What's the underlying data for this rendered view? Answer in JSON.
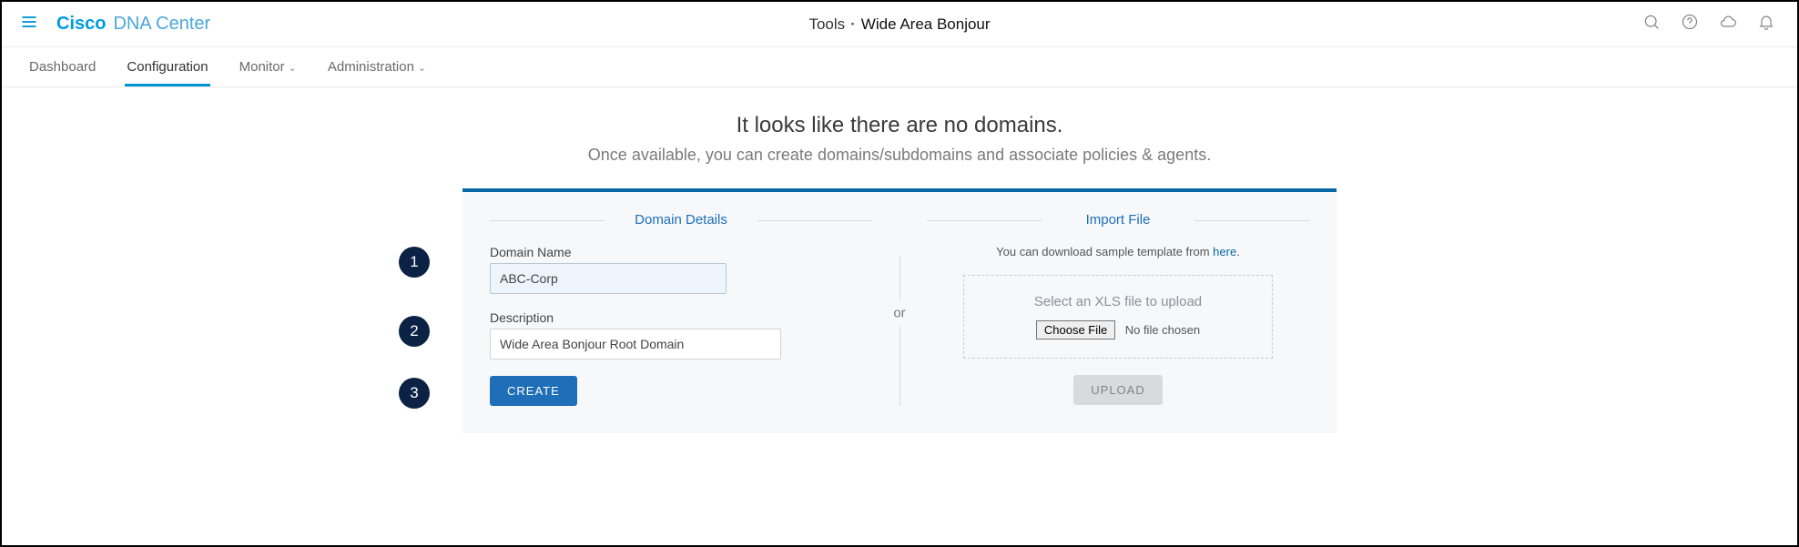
{
  "header": {
    "brand_cisco": "Cisco",
    "brand_dna": "DNA Center",
    "title_tools": "Tools",
    "title_page": "Wide Area Bonjour"
  },
  "tabs": {
    "dashboard": "Dashboard",
    "configuration": "Configuration",
    "monitor": "Monitor",
    "administration": "Administration"
  },
  "empty": {
    "heading": "It looks like there are no domains.",
    "sub": "Once available, you can create domains/subdomains and associate policies & agents."
  },
  "card": {
    "domain_section_title": "Domain Details",
    "domain_name_label": "Domain Name",
    "domain_name_value": "ABC-Corp",
    "description_label": "Description",
    "description_value": "Wide Area Bonjour Root Domain",
    "create_btn": "CREATE",
    "or": "or",
    "import_section_title": "Import File",
    "download_note_prefix": "You can download sample template from ",
    "download_note_link": "here",
    "download_note_suffix": ".",
    "upload_box_title": "Select an XLS file to upload",
    "choose_file_btn": "Choose File",
    "no_file_chosen": "No file chosen",
    "upload_btn": "UPLOAD"
  },
  "callouts": {
    "c1": "1",
    "c2": "2",
    "c3": "3"
  }
}
